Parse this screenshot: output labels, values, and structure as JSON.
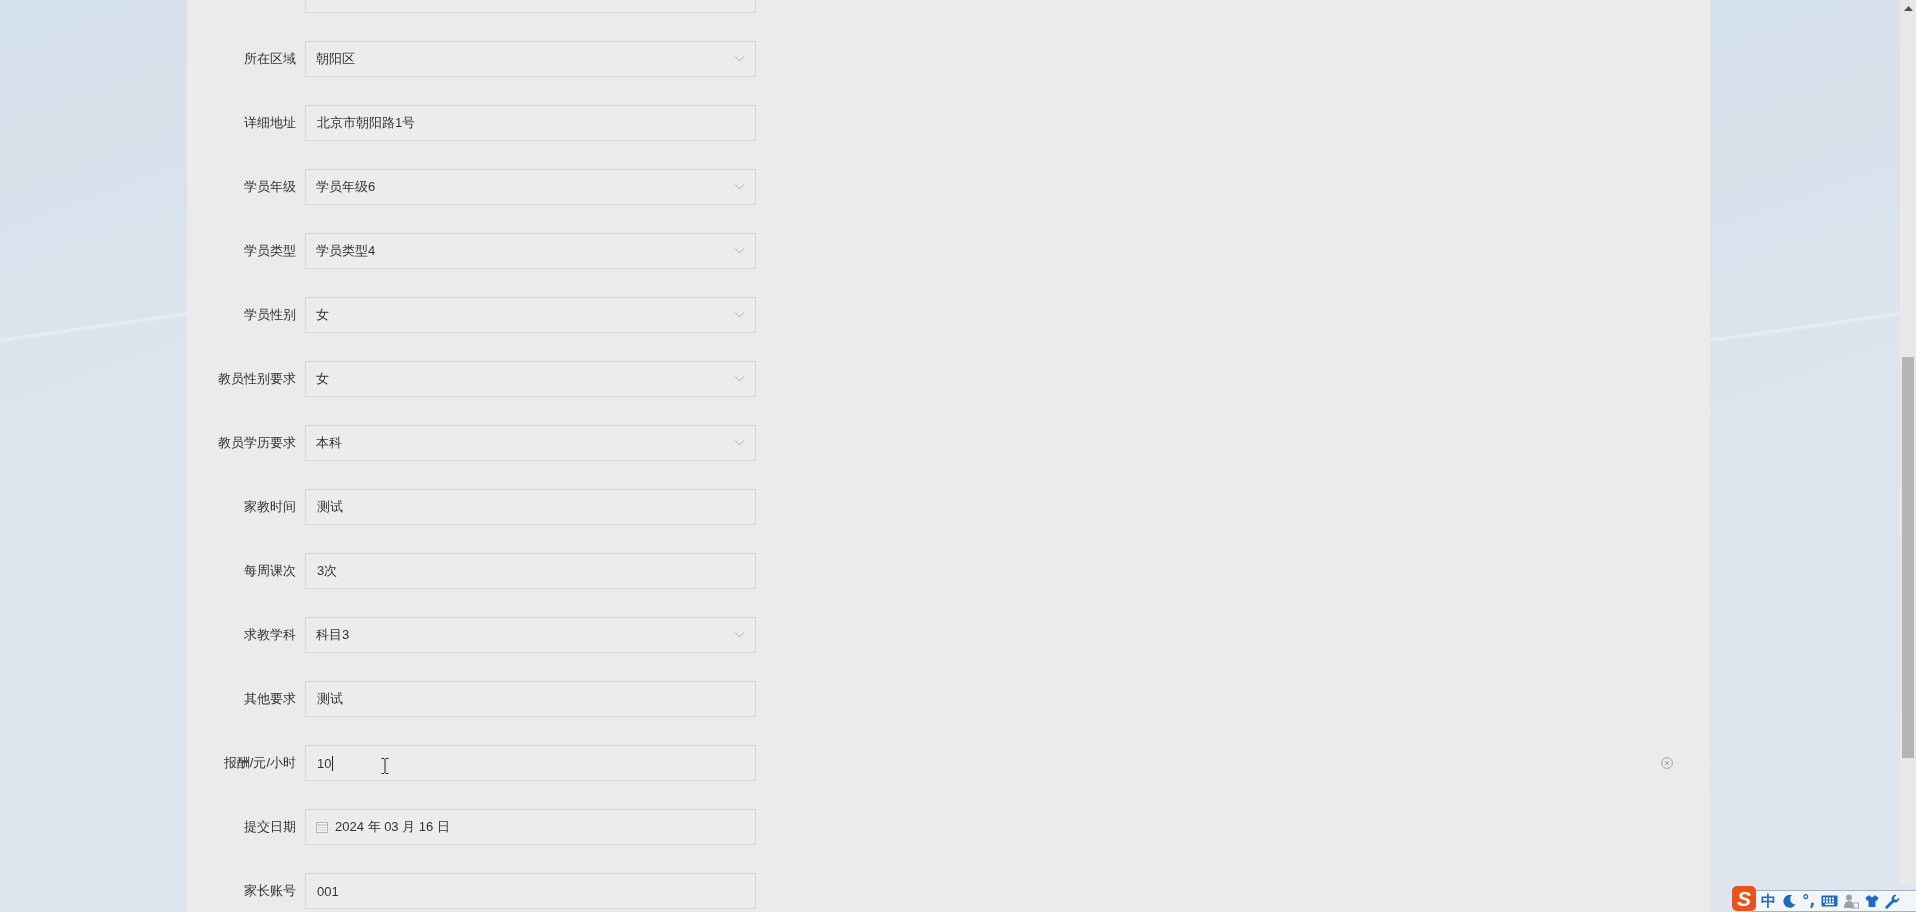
{
  "form": {
    "rows": [
      {
        "kind": "input",
        "focused": false,
        "clearable": false
      },
      {
        "label": "所在区域",
        "kind": "select",
        "value": "朝阳区",
        "focused": false,
        "clearable": false
      },
      {
        "label": "详细地址",
        "kind": "input",
        "value": "北京市朝阳路1号",
        "focused": false,
        "clearable": false
      },
      {
        "label": "学员年级",
        "kind": "select",
        "value": "学员年级6",
        "focused": false,
        "clearable": false
      },
      {
        "label": "学员类型",
        "kind": "select",
        "value": "学员类型4",
        "focused": false,
        "clearable": false
      },
      {
        "label": "学员性别",
        "kind": "select",
        "value": "女",
        "focused": false,
        "clearable": false
      },
      {
        "label": "教员性别要求",
        "kind": "select",
        "value": "女",
        "focused": false,
        "clearable": false
      },
      {
        "label": "教员学历要求",
        "kind": "select",
        "value": "本科",
        "focused": false,
        "clearable": false
      },
      {
        "label": "家教时间",
        "kind": "input",
        "value": "测试",
        "focused": false,
        "clearable": false
      },
      {
        "label": "每周课次",
        "kind": "input",
        "value": "3次",
        "focused": false,
        "clearable": false
      },
      {
        "label": "求教学科",
        "kind": "select",
        "value": "科目3",
        "focused": false,
        "clearable": false
      },
      {
        "label": "其他要求",
        "kind": "input",
        "value": "测试",
        "focused": false,
        "clearable": false
      },
      {
        "label": "报酬/元/小时",
        "kind": "input",
        "value": "10",
        "focused": true,
        "clearable": true
      },
      {
        "label": "提交日期",
        "kind": "date",
        "value": "2024 年 03 月 16 日",
        "focused": false,
        "clearable": false
      },
      {
        "label": "家长账号",
        "kind": "input",
        "value": "001",
        "focused": false,
        "clearable": false
      }
    ]
  },
  "ime_toolbar": {
    "logo": "S",
    "mode": "中",
    "punctuation": "°,"
  }
}
